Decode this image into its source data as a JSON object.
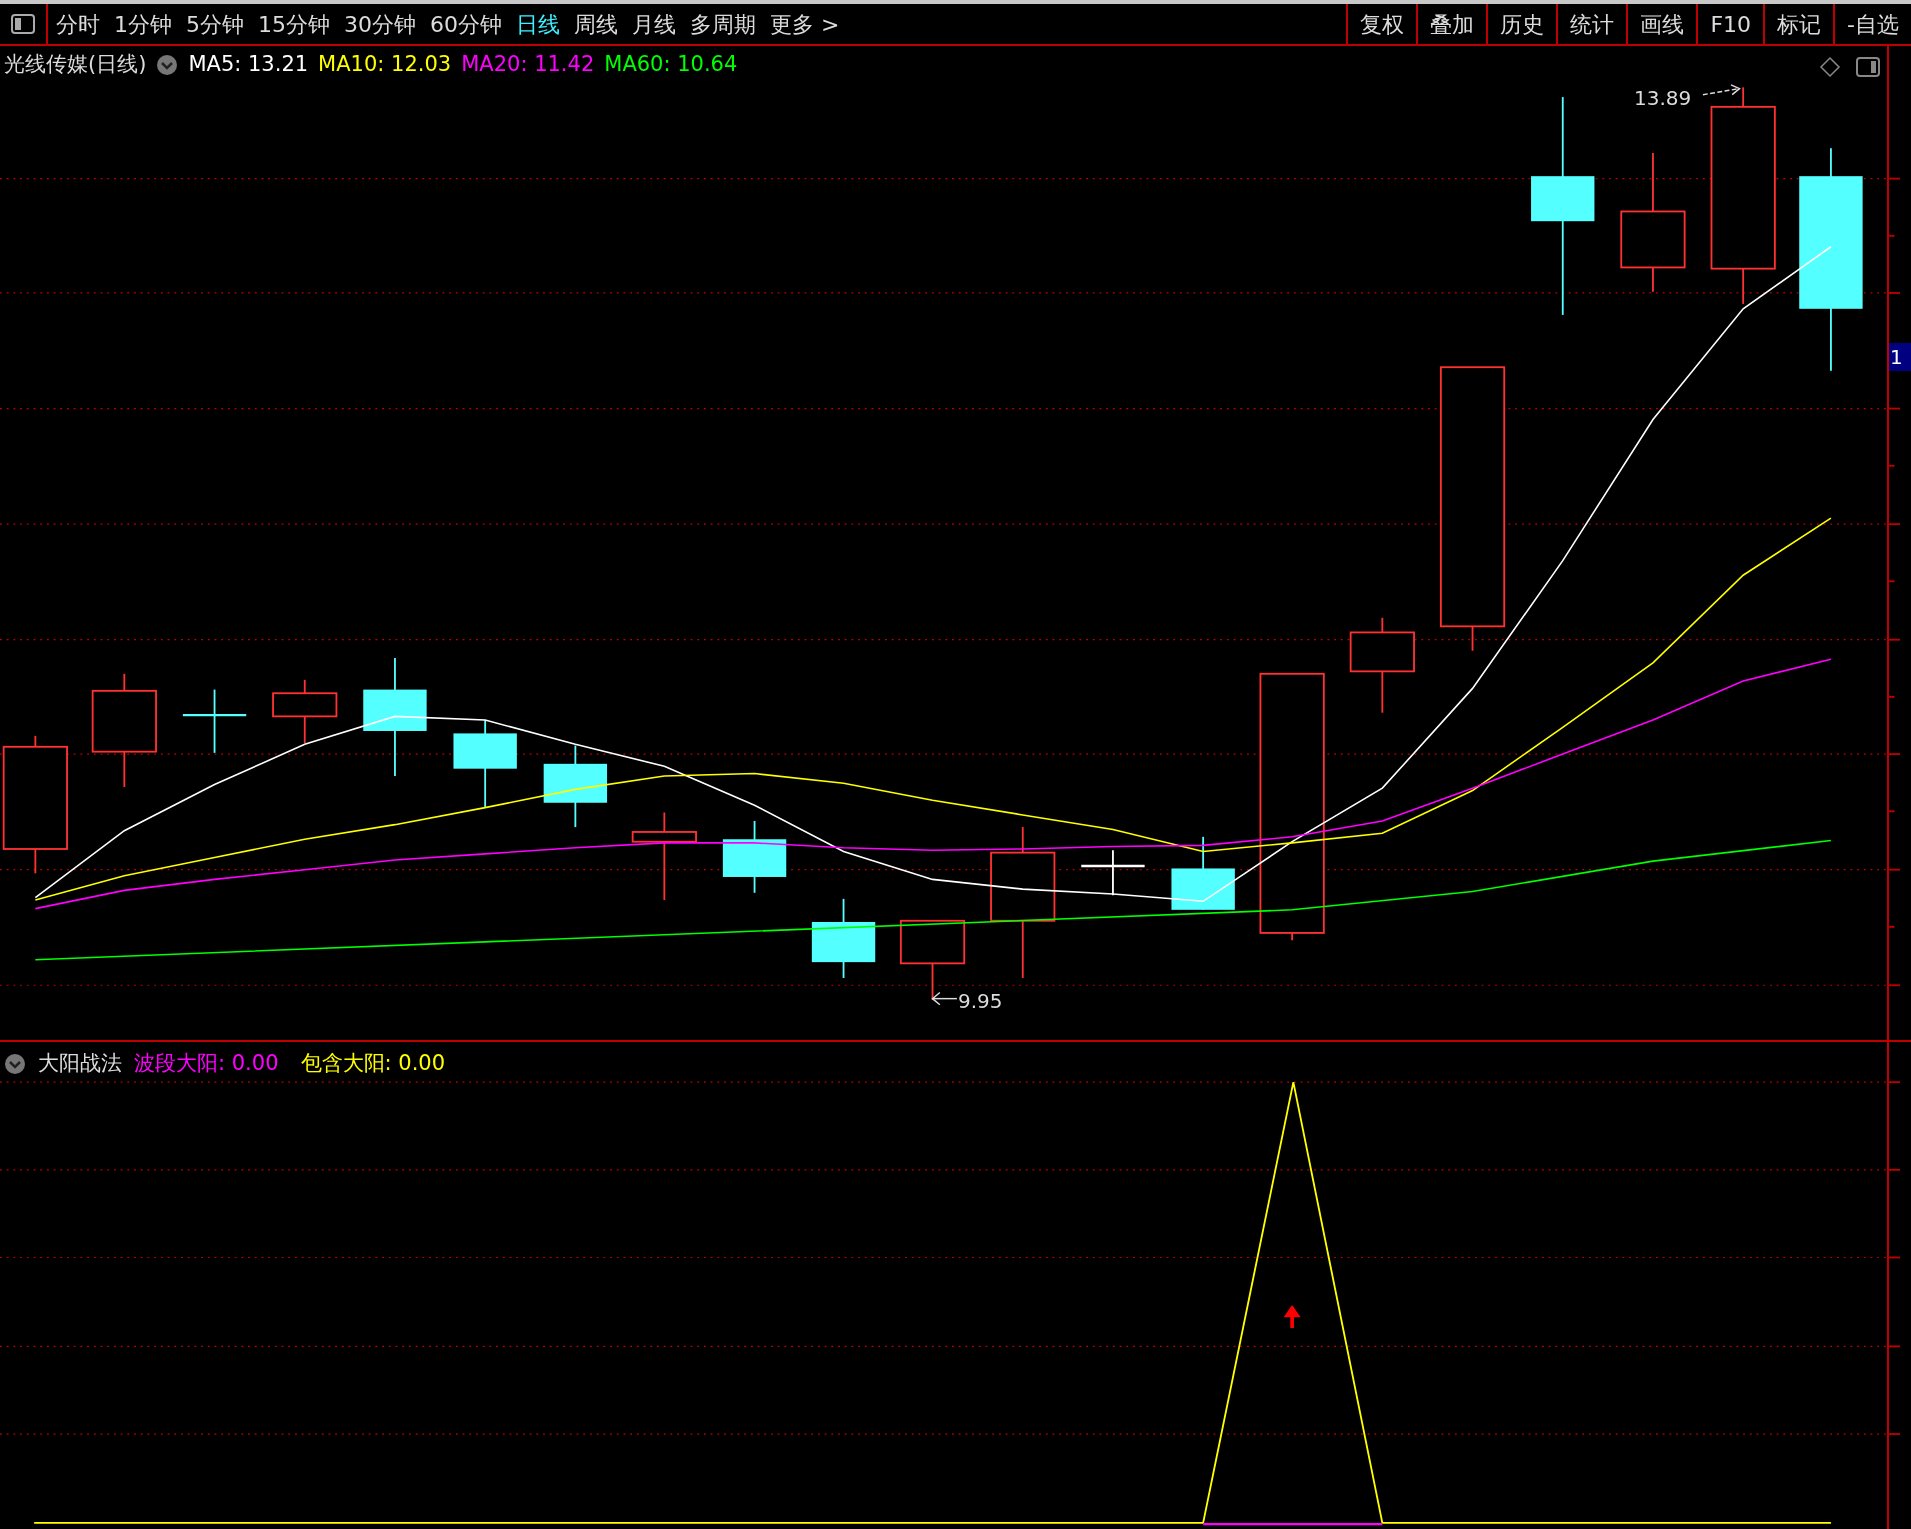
{
  "toolbar": {
    "tabs": [
      {
        "label": "分时",
        "selected": false
      },
      {
        "label": "1分钟",
        "selected": false
      },
      {
        "label": "5分钟",
        "selected": false
      },
      {
        "label": "15分钟",
        "selected": false
      },
      {
        "label": "30分钟",
        "selected": false
      },
      {
        "label": "60分钟",
        "selected": false
      },
      {
        "label": "日线",
        "selected": true
      },
      {
        "label": "周线",
        "selected": false
      },
      {
        "label": "月线",
        "selected": false
      },
      {
        "label": "多周期",
        "selected": false
      },
      {
        "label": "更多 >",
        "selected": false
      }
    ],
    "tools": [
      "复权",
      "叠加",
      "历史",
      "统计",
      "画线",
      "F10",
      "标记",
      "-自选"
    ]
  },
  "main_chart": {
    "title": "光线传媒(日线)",
    "moving_averages": [
      {
        "label": "MA5: 13.21",
        "color": "#ffffff"
      },
      {
        "label": "MA10: 12.03",
        "color": "#ffff00"
      },
      {
        "label": "MA20: 11.42",
        "color": "#ff00ff"
      },
      {
        "label": "MA60: 10.64",
        "color": "#00ff00"
      }
    ],
    "high_label": "13.89",
    "low_label": "9.95",
    "axis_label": "1"
  },
  "indicator": {
    "name": "大阳战法",
    "values": [
      {
        "label": "波段大阳: 0.00",
        "color": "#ff00ff"
      },
      {
        "label": "包含大阳: 0.00",
        "color": "#ffff00"
      }
    ]
  }
}
